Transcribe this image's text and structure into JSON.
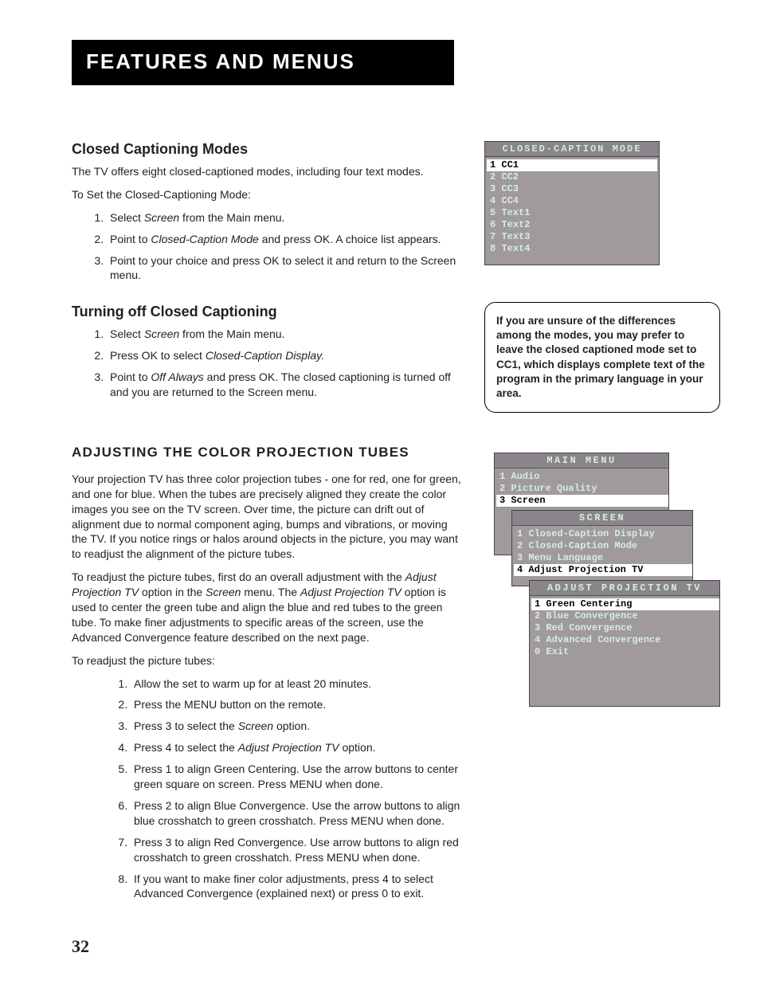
{
  "header": "Features and Menus",
  "page_number": "32",
  "sec1": {
    "h": "Closed Captioning Modes",
    "p1": "The TV offers eight closed-captioned modes, including four text modes.",
    "p2": "To Set the Closed-Captioning Mode:",
    "steps": {
      "s1a": "Select ",
      "s1i": "Screen",
      "s1b": " from the Main menu.",
      "s2a": "Point to ",
      "s2i": "Closed-Caption Mode",
      "s2b": " and press OK.  A choice list appears.",
      "s3": "Point to your choice and press OK to select it and return to the Screen menu."
    }
  },
  "sec2": {
    "h": "Turning off Closed Captioning",
    "steps": {
      "s1a": "Select ",
      "s1i": "Screen",
      "s1b": " from the Main menu.",
      "s2a": "Press OK to select ",
      "s2i": "Closed-Caption Display.",
      "s3a": "Point to ",
      "s3i": "Off Always",
      "s3b": " and press OK. The closed captioning is turned off and you are returned to the Screen menu."
    }
  },
  "sec3": {
    "h": "Adjusting the Color Projection Tubes",
    "p1": "Your projection TV has three color projection tubes - one for red, one for green, and one for blue. When the tubes are precisely aligned they create the color images you see on the TV screen. Over time, the picture can drift out of alignment due to normal component aging, bumps and vibrations, or moving the TV. If you notice rings or halos around objects in the picture, you may want to readjust the alignment of the picture tubes.",
    "p2a": "To readjust the picture tubes, first do an overall adjustment with the ",
    "p2i1": "Adjust Projection TV",
    "p2b": " option in the ",
    "p2i2": "Screen",
    "p2c": " menu. The ",
    "p2i3": "Adjust Projection TV",
    "p2d": " option is used to center the green tube and align the blue and red tubes to the green tube. To make finer adjustments to specific areas of the screen, use the Advanced Convergence feature described on the next page.",
    "p3": "To readjust the picture tubes:",
    "steps": {
      "s1": "Allow the set to warm up for at least 20 minutes.",
      "s2": "Press the MENU button on the remote.",
      "s3a": "Press 3 to select the ",
      "s3i": "Screen",
      "s3b": " option.",
      "s4a": "Press 4 to select the ",
      "s4i": "Adjust Projection TV",
      "s4b": " option.",
      "s5": "Press 1 to align Green Centering.  Use the arrow buttons to center green square on screen.  Press MENU when done.",
      "s6": "Press 2 to align Blue Convergence.  Use the arrow buttons to align blue crosshatch to green crosshatch.  Press MENU when done.",
      "s7": "Press 3 to align Red Convergence.  Use arrow buttons to align red crosshatch to green crosshatch.  Press MENU when done.",
      "s8": "If you want to make finer color adjustments, press 4 to select Advanced Convergence (explained next) or press 0 to exit."
    }
  },
  "cc_menu": {
    "title": "CLOSED-CAPTION MODE",
    "rows": {
      "r1": "1 CC1",
      "r2": "2 CC2",
      "r3": "3 CC3",
      "r4": "4 CC4",
      "r5": "5 Text1",
      "r6": "6 Text2",
      "r7": "7 Text3",
      "r8": "8 Text4"
    }
  },
  "callout": "If you are unsure of the differences among the modes, you may prefer to leave the closed captioned mode set to CC1, which displays complete text of the program in the primary language in your area.",
  "main_menu": {
    "title": "MAIN MENU",
    "rows": {
      "r1": "1 Audio",
      "r2": "2 Picture Quality",
      "r3": "3 Screen"
    }
  },
  "screen_menu": {
    "title": "SCREEN",
    "rows": {
      "r1": "1 Closed-Caption Display",
      "r2": "2 Closed-Caption Mode",
      "r3": "3 Menu Language",
      "r4": "4 Adjust Projection TV"
    }
  },
  "adjust_menu": {
    "title": "ADJUST PROJECTION TV",
    "rows": {
      "r1": "1 Green Centering",
      "r2": "2 Blue Convergence",
      "r3": "3 Red Convergence",
      "r4": "4 Advanced Convergence",
      "r5": "0 Exit"
    }
  }
}
